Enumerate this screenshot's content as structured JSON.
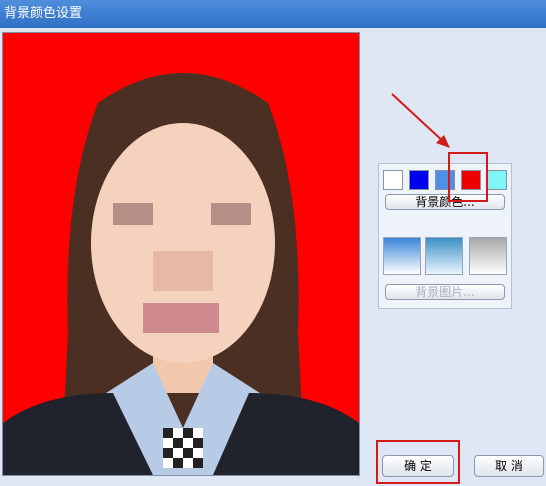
{
  "window": {
    "title": "背景颜色设置"
  },
  "panel": {
    "swatches": [
      {
        "name": "white",
        "color": "#ffffff"
      },
      {
        "name": "blue",
        "color": "#0000ee"
      },
      {
        "name": "light-blue",
        "color": "#4f8fe8"
      },
      {
        "name": "red",
        "color": "#ee0000"
      },
      {
        "name": "cyan",
        "color": "#7ff5f5"
      }
    ],
    "bg_color_button": "背景颜色...",
    "bg_image_button": "背景图片..."
  },
  "footer": {
    "ok_label": "确  定",
    "cancel_label": "取  消"
  },
  "colors": {
    "photo_background": "#ff0000",
    "highlight": "#d21a1a"
  }
}
